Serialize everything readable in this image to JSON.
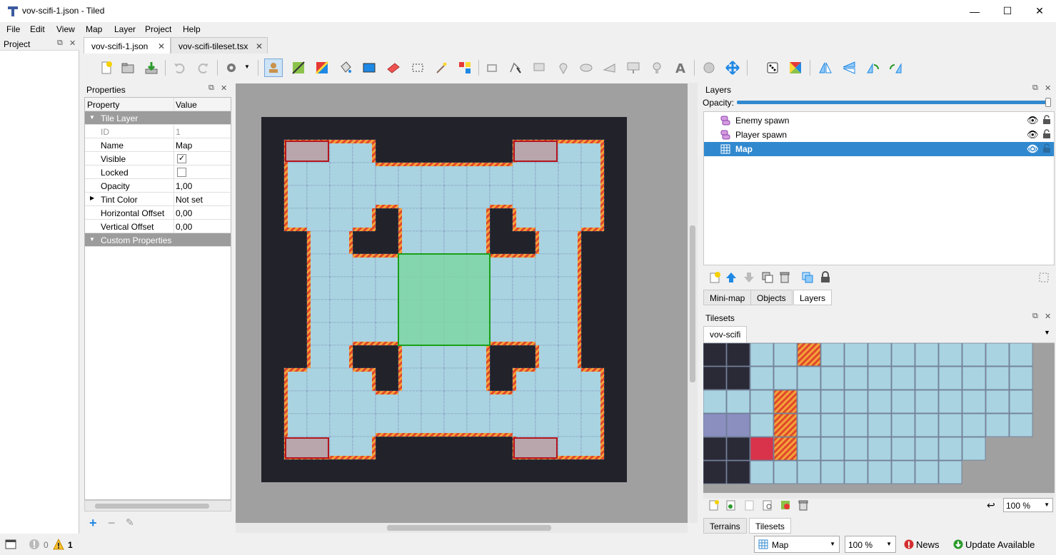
{
  "window": {
    "title": "vov-scifi-1.json - Tiled",
    "minimize": "—",
    "maximize": "☐",
    "close": "✕"
  },
  "menu": [
    "File",
    "Edit",
    "View",
    "Map",
    "Layer",
    "Project",
    "Help"
  ],
  "project_panel": {
    "title": "Project"
  },
  "tabs": [
    {
      "label": "vov-scifi-1.json",
      "close": "✕",
      "active": true
    },
    {
      "label": "vov-scifi-tileset.tsx",
      "close": "✕",
      "active": false
    }
  ],
  "properties": {
    "title": "Properties",
    "col_property": "Property",
    "col_value": "Value",
    "group_tile_layer": "Tile Layer",
    "rows": [
      {
        "name": "ID",
        "value": "1"
      },
      {
        "name": "Name",
        "value": "Map"
      },
      {
        "name": "Visible",
        "value": "✓"
      },
      {
        "name": "Locked",
        "value": ""
      },
      {
        "name": "Opacity",
        "value": "1,00"
      },
      {
        "name": "Tint Color",
        "value": "Not set"
      },
      {
        "name": "Horizontal Offset",
        "value": "0,00"
      },
      {
        "name": "Vertical Offset",
        "value": "0,00"
      }
    ],
    "group_custom": "Custom Properties"
  },
  "layers": {
    "title": "Layers",
    "opacity_label": "Opacity:",
    "opacity": 1.0,
    "items": [
      {
        "name": "Enemy spawn",
        "type": "object",
        "selected": false
      },
      {
        "name": "Player spawn",
        "type": "object",
        "selected": false
      },
      {
        "name": "Map",
        "type": "tile",
        "selected": true
      }
    ],
    "bottom_tabs": [
      "Mini-map",
      "Objects",
      "Layers"
    ]
  },
  "tilesets": {
    "title": "Tilesets",
    "current": "vov-scifi",
    "zoom": "100 %",
    "bottom_tabs": [
      "Terrains",
      "Tilesets"
    ]
  },
  "status": {
    "errors": "0",
    "warnings": "1",
    "layer_select": "Map",
    "zoom": "100 %",
    "news": "News",
    "update": "Update Available"
  },
  "colors": {
    "floor": "#a9d3e1",
    "wall": "#e0472a",
    "space": "#22222b",
    "selection": "#7ed6a4",
    "selected_layer": "#3089cf"
  }
}
